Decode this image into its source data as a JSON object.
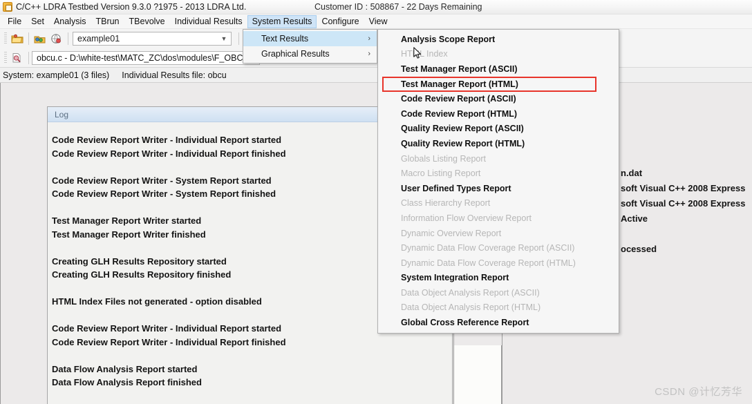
{
  "window": {
    "title": "C/C++ LDRA Testbed Version 9.3.0 ?1975 - 2013 LDRA Ltd.",
    "customer_info": "Customer ID : 508867 - 22 Days Remaining",
    "app_icon": "ldra-app-icon"
  },
  "menubar": {
    "items": [
      {
        "label": "File",
        "active": false
      },
      {
        "label": "Set",
        "active": false
      },
      {
        "label": "Analysis",
        "active": false
      },
      {
        "label": "TBrun",
        "active": false
      },
      {
        "label": "TBevolve",
        "active": false
      },
      {
        "label": "Individual Results",
        "active": false
      },
      {
        "label": "System Results",
        "active": true
      },
      {
        "label": "Configure",
        "active": false
      },
      {
        "label": "View",
        "active": false
      }
    ]
  },
  "toolbar_top": {
    "icons": [
      "open-folder-icon",
      "add-set-icon",
      "globe-set-icon",
      "checklist-icon",
      "document-green-icon"
    ],
    "set_combo": {
      "value": "example01",
      "chevron": "chevron-down-icon"
    }
  },
  "toolbar_second": {
    "icons": [
      "analyse-file-icon"
    ],
    "file_path": {
      "value": "obcu.c - D:\\white-test\\MATC_ZC\\dos\\modules\\F_OBCU,"
    }
  },
  "status_strip": {
    "system": "System: example01 (3 files)",
    "individual_results": "Individual Results file: obcu"
  },
  "system_results_menu": {
    "items": [
      {
        "label": "Text Results",
        "selected": true,
        "arrow": "submenu-arrow-icon"
      },
      {
        "label": "Graphical Results",
        "selected": false,
        "arrow": "submenu-arrow-icon"
      }
    ]
  },
  "text_results_submenu": {
    "items": [
      {
        "label": "Analysis Scope Report",
        "enabled": true,
        "highlighted": false
      },
      {
        "label": "HTML Index",
        "enabled": false,
        "highlighted": false
      },
      {
        "label": "Test Manager Report (ASCII)",
        "enabled": true,
        "highlighted": false
      },
      {
        "label": "Test Manager Report (HTML)",
        "enabled": true,
        "highlighted": true
      },
      {
        "label": "Code Review Report (ASCII)",
        "enabled": true,
        "highlighted": false
      },
      {
        "label": "Code Review Report (HTML)",
        "enabled": true,
        "highlighted": false
      },
      {
        "label": "Quality Review Report (ASCII)",
        "enabled": true,
        "highlighted": false
      },
      {
        "label": "Quality Review Report (HTML)",
        "enabled": true,
        "highlighted": false
      },
      {
        "label": "Globals Listing Report",
        "enabled": false,
        "highlighted": false
      },
      {
        "label": "Macro Listing Report",
        "enabled": false,
        "highlighted": false
      },
      {
        "label": "User Defined Types Report",
        "enabled": true,
        "highlighted": false
      },
      {
        "label": "Class Hierarchy Report",
        "enabled": false,
        "highlighted": false
      },
      {
        "label": "Information Flow Overview Report",
        "enabled": false,
        "highlighted": false
      },
      {
        "label": "Dynamic Overview Report",
        "enabled": false,
        "highlighted": false
      },
      {
        "label": "Dynamic Data Flow Coverage Report (ASCII)",
        "enabled": false,
        "highlighted": false
      },
      {
        "label": "Dynamic Data Flow Coverage Report (HTML)",
        "enabled": false,
        "highlighted": false
      },
      {
        "label": "System Integration Report",
        "enabled": true,
        "highlighted": false
      },
      {
        "label": "Data Object Analysis Report (ASCII)",
        "enabled": false,
        "highlighted": false
      },
      {
        "label": "Data Object Analysis Report (HTML)",
        "enabled": false,
        "highlighted": false
      },
      {
        "label": "Global Cross Reference Report",
        "enabled": true,
        "highlighted": false
      }
    ],
    "highlight_border_color": "#e8342a"
  },
  "log_panel": {
    "caption": "Log",
    "lines": [
      "Code Review Report Writer - Individual Report started",
      "Code Review Report Writer - Individual Report finished",
      "",
      "Code Review Report Writer - System Report started",
      "Code Review Report Writer - System Report finished",
      "",
      "Test Manager Report Writer started",
      "Test Manager Report Writer finished",
      "",
      "Creating GLH Results Repository started",
      "Creating GLH Results Repository finished",
      "",
      "HTML Index Files not generated - option disabled",
      "",
      "Code Review Report Writer - Individual Report started",
      "Code Review Report Writer - Individual Report finished",
      "",
      "Data Flow Analysis Report started",
      "Data Flow Analysis Report finished"
    ]
  },
  "right_panel": {
    "lines": [
      "n.dat",
      "soft Visual C++ 2008 Express",
      "soft Visual C++ 2008 Express",
      " Active",
      "",
      "ocessed"
    ]
  },
  "watermark": {
    "text": "CSDN @计忆芳华"
  },
  "cursor": {
    "name": "mouse-pointer"
  },
  "colors": {
    "menu_highlight": "#cde6f7",
    "menubar_active": "#cfe4f7",
    "red_box": "#e8342a",
    "log_caption": "#cfe0f2"
  }
}
